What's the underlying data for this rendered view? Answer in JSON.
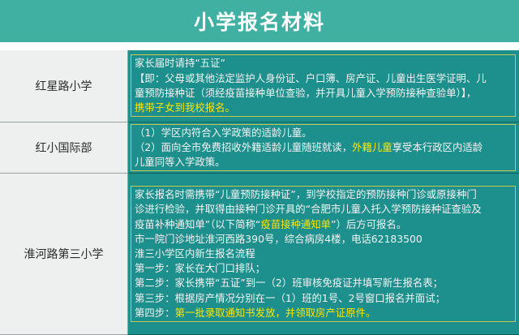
{
  "title": "小学报名材料",
  "rows": [
    {
      "school": "红星路小学",
      "lines": [
        [
          {
            "t": "家长届时请持“五证”"
          }
        ],
        [
          {
            "t": "【即：父母或其他法定监护人身份证、户口簿、房产证、儿童出生医学证明、儿"
          }
        ],
        [
          {
            "t": "童预防接种证（须经疫苗接种单位查验，并开具儿童入学预防接种查验单）】，"
          }
        ],
        [
          {
            "t": "携带子女到我校报名。",
            "hl": true
          }
        ]
      ]
    },
    {
      "school": "红小国际部",
      "lines": [
        [
          {
            "t": "（1）学区内符合入学政策的适龄儿童。"
          }
        ],
        [
          {
            "t": "（2）面向全市免费招收外籍适龄儿童随班就读，"
          },
          {
            "t": "外籍儿童",
            "hl": true
          },
          {
            "t": "享受本行政区内适龄"
          }
        ],
        [
          {
            "t": "儿童同等入学政策。"
          }
        ]
      ]
    },
    {
      "school": "淮河路第三小学",
      "lines": [
        [
          {
            "t": "家长报名时需携带“儿童预防接种证”，到学校指定的预防接种门诊或原接种门"
          }
        ],
        [
          {
            "t": "诊进行检验，并取得由接种门诊开具的“合肥市儿童入托入学预防接种证查验及"
          }
        ],
        [
          {
            "t": "疫苗补种通知单”（以下简称“"
          },
          {
            "t": "疫苗接种通知单",
            "hl": true
          },
          {
            "t": "”）后方可报名。"
          }
        ],
        [
          {
            "t": "市一院门诊地址淮河西路390号，综合病房4楼，电话62183500"
          }
        ],
        [
          {
            "t": "淮三小学区内新生报名流程"
          }
        ],
        [
          {
            "t": "第一步：家长在大门口排队；"
          }
        ],
        [
          {
            "t": "第二步：家长携带“五证”到一（2）班审核免疫证并填写新生报名表；"
          }
        ],
        [
          {
            "t": "第三步：根据房产情况分别在一（1）班的1号、2号窗口报名并面试；"
          }
        ],
        [
          {
            "t": "第四步："
          },
          {
            "t": "第一批录取通知书发放，并领取房产证原件。",
            "hl": true
          }
        ]
      ]
    }
  ]
}
